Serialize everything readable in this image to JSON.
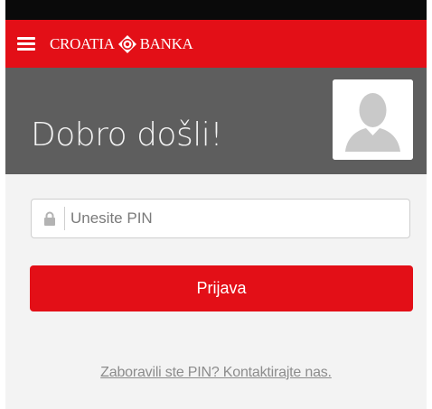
{
  "header": {
    "logo_left": "CROATIA",
    "logo_right": "BANKA"
  },
  "hero": {
    "welcome_text": "Dobro došli!"
  },
  "login": {
    "pin_placeholder": "Unesite PIN",
    "login_button": "Prijava",
    "forgot_link": "Zaboravili ste PIN? Kontaktirajte nas."
  },
  "colors": {
    "brand_red": "#e30f17",
    "hero_gray": "#5e5e5e",
    "background": "#f3f3f3"
  },
  "icons": {
    "menu": "hamburger-menu-icon",
    "logo": "croatia-banka-logo-mark",
    "avatar": "user-avatar-placeholder-icon",
    "lock": "lock-icon"
  }
}
